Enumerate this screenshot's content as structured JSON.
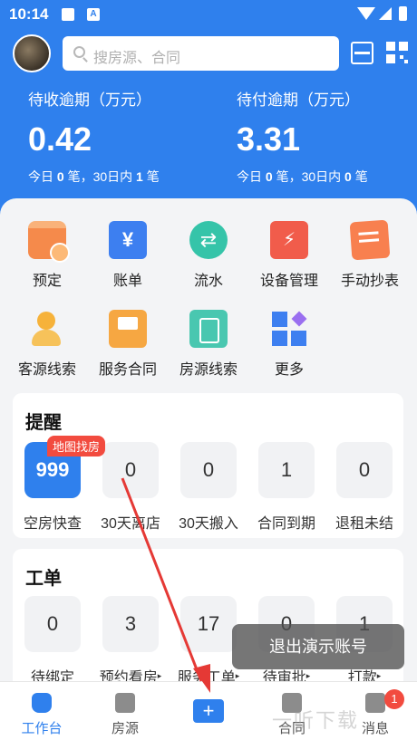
{
  "status_bar": {
    "time": "10:14",
    "a_icon": "A"
  },
  "header": {
    "search_placeholder": "搜房源、合同",
    "receivable": {
      "title": "待收逾期（万元）",
      "value": "0.42",
      "today_label": "今日",
      "today_count": "0",
      "unit": "笔，",
      "month_label": "30日内",
      "month_count": "1",
      "month_unit": "笔"
    },
    "payable": {
      "title": "待付逾期（万元）",
      "value": "3.31",
      "today_label": "今日",
      "today_count": "0",
      "unit": "笔，",
      "month_label": "30日内",
      "month_count": "0",
      "month_unit": "笔"
    }
  },
  "features": [
    {
      "label": "预定",
      "icon": "calendar-icon"
    },
    {
      "label": "账单",
      "icon": "bill-icon",
      "glyph": "¥"
    },
    {
      "label": "流水",
      "icon": "transfer-icon",
      "glyph": "⇄"
    },
    {
      "label": "设备管理",
      "icon": "device-icon",
      "glyph": "⚡"
    },
    {
      "label": "手动抄表",
      "icon": "meter-icon"
    },
    {
      "label": "客源线索",
      "icon": "customer-icon"
    },
    {
      "label": "服务合同",
      "icon": "contract-icon"
    },
    {
      "label": "房源线索",
      "icon": "house-icon"
    },
    {
      "label": "更多",
      "icon": "more-icon"
    }
  ],
  "reminders": {
    "title": "提醒",
    "badge": "地图找房",
    "items": [
      {
        "value": "999",
        "label": "空房快查"
      },
      {
        "value": "0",
        "label": "30天离店"
      },
      {
        "value": "0",
        "label": "30天搬入"
      },
      {
        "value": "1",
        "label": "合同到期"
      },
      {
        "value": "0",
        "label": "退租未结"
      }
    ]
  },
  "work_orders": {
    "title": "工单",
    "items": [
      {
        "value": "0",
        "label": "待绑定"
      },
      {
        "value": "3",
        "label": "预约看房",
        "arrow": "▸"
      },
      {
        "value": "17",
        "label": "服务工单",
        "arrow": "▸"
      },
      {
        "value": "0",
        "label": "待审批",
        "arrow": "▸"
      },
      {
        "value": "1",
        "label": "打款",
        "arrow": "▸"
      }
    ]
  },
  "toast": "退出演示账号",
  "tabbar": [
    {
      "label": "工作台",
      "icon": "home-icon"
    },
    {
      "label": "房源",
      "icon": "building-icon"
    },
    {
      "label": "",
      "icon": "add-icon",
      "glyph": "+"
    },
    {
      "label": "合同",
      "icon": "contract-tab-icon"
    },
    {
      "label": "消息",
      "icon": "message-icon",
      "badge": "1"
    }
  ],
  "watermark": "一听下载",
  "colors": {
    "primary": "#2f80ed",
    "badge": "#f24b3f",
    "annotation_arrow": "#e53935"
  }
}
